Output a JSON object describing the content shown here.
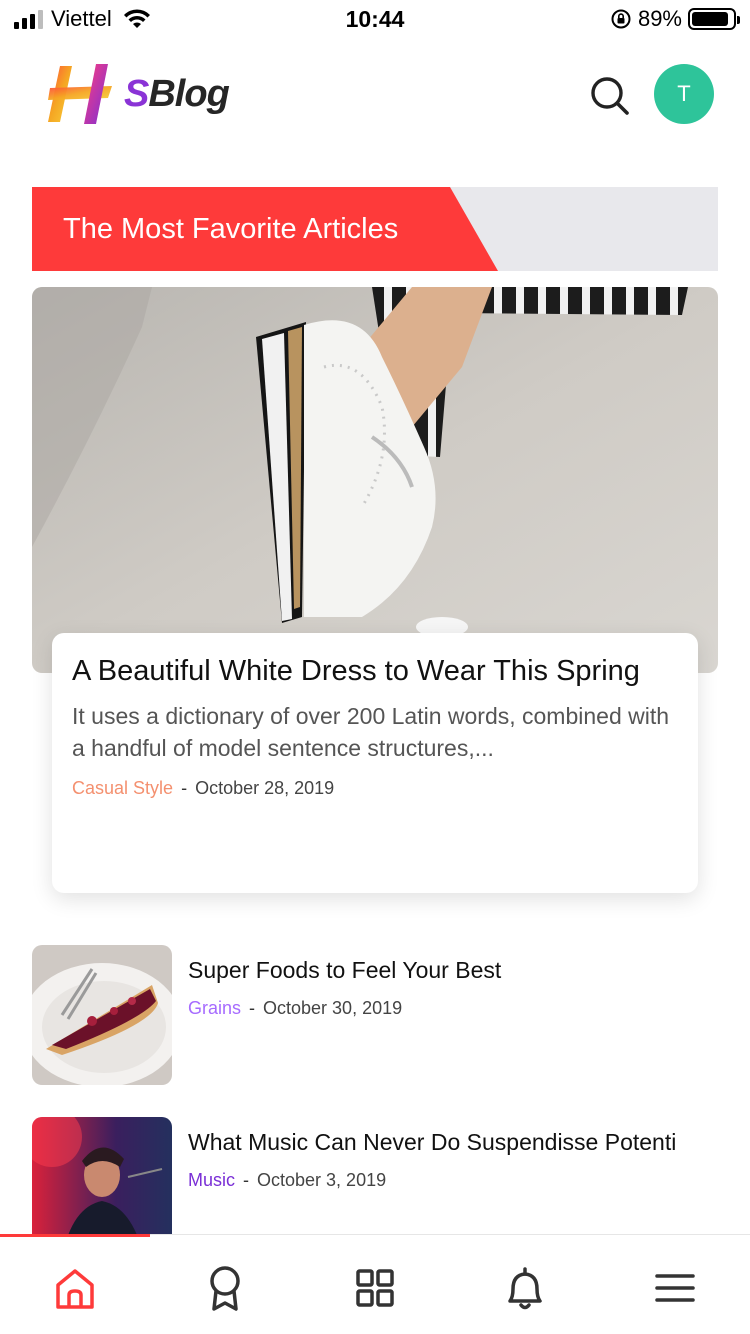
{
  "status_bar": {
    "carrier": "Viettel",
    "time": "10:44",
    "battery_percent": "89%",
    "battery_level": 0.89
  },
  "header": {
    "logo_s": "S",
    "logo_blog": "Blog",
    "avatar_initial": "T"
  },
  "section": {
    "title": "The Most Favorite Articles"
  },
  "featured": {
    "title": "A Beautiful White Dress to Wear This Spring",
    "excerpt": "It uses a dictionary of over 200 Latin words, combined with a handful of model sentence structures,...",
    "category": "Casual Style",
    "separator": "-",
    "date": "October 28, 2019"
  },
  "articles": [
    {
      "title": "Super Foods to Feel Your Best",
      "category": "Grains",
      "separator": "-",
      "date": "October 30, 2019"
    },
    {
      "title": "What Music Can Never Do Suspendisse Potenti",
      "category": "Music",
      "separator": "-",
      "date": "October 3, 2019"
    }
  ],
  "tabbar": {
    "items": [
      {
        "icon": "home-icon",
        "active": true
      },
      {
        "icon": "award-icon",
        "active": false
      },
      {
        "icon": "grid-icon",
        "active": false
      },
      {
        "icon": "bell-icon",
        "active": false
      },
      {
        "icon": "menu-icon",
        "active": false
      }
    ]
  },
  "colors": {
    "accent": "#fe3a3a",
    "avatar": "#2ec49a",
    "casual": "#f4906f",
    "grains": "#a66bff",
    "music": "#7a2fd6"
  }
}
